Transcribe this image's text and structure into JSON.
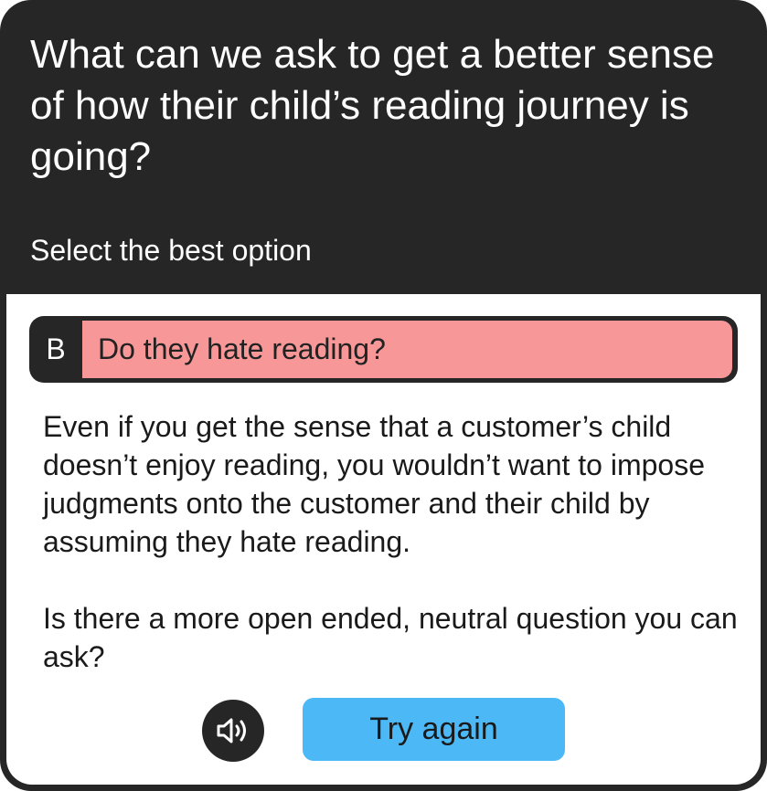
{
  "prompt": {
    "question": "What can we ask to get a better sense of how their child’s reading journey is going?",
    "instruction": "Select the best option"
  },
  "selected_option": {
    "letter": "B",
    "text": "Do they hate reading?"
  },
  "feedback": {
    "paragraphs": [
      "Even if you get the sense that a customer’s child doesn’t enjoy reading, you wouldn’t want to impose judgments onto the customer and their child by assuming they hate reading.",
      "Is there a more open ended, neutral question you can ask?"
    ]
  },
  "actions": {
    "audio_icon": "speaker-icon",
    "try_again_label": "Try again"
  },
  "colors": {
    "card_background": "#262626",
    "incorrect_option": "#f79797",
    "try_again_button": "#4cb8f5"
  }
}
